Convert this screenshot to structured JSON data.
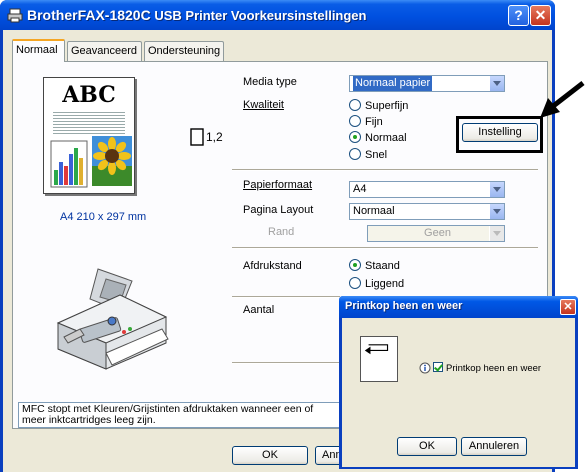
{
  "window": {
    "title_brand": "Brother",
    "title_model": "FAX-1820C",
    "title_rest": "USB Printer Voorkeursinstellingen",
    "help_label": "?",
    "close_label": "✕"
  },
  "tabs": [
    {
      "label": "Normaal",
      "active": true
    },
    {
      "label": "Geavanceerd",
      "active": false
    },
    {
      "label": "Ondersteuning",
      "active": false
    }
  ],
  "preview": {
    "sample_text": "ABC",
    "copies": "1,2",
    "paper_size_text": "A4 210 x 297 mm"
  },
  "media_type": {
    "label": "Media type",
    "value": "Normaal papier"
  },
  "quality": {
    "label": "Kwaliteit",
    "options": [
      {
        "label": "Superfijn",
        "selected": false
      },
      {
        "label": "Fijn",
        "selected": false
      },
      {
        "label": "Normaal",
        "selected": true
      },
      {
        "label": "Snel",
        "selected": false
      }
    ],
    "settings_button": "Instelling"
  },
  "paper_size": {
    "label": "Papierformaat",
    "value": "A4"
  },
  "page_layout": {
    "label": "Pagina Layout",
    "value": "Normaal"
  },
  "border": {
    "label": "Rand",
    "value": "Geen"
  },
  "orientation": {
    "label": "Afdrukstand",
    "options": [
      {
        "label": "Staand",
        "selected": true
      },
      {
        "label": "Liggend",
        "selected": false
      }
    ]
  },
  "copies": {
    "label": "Aantal"
  },
  "status_note": "MFC stopt met Kleuren/Grijstinten afdruktaken wanneer een of meer inktcartridges leeg zijn.",
  "footer": {
    "ok": "OK",
    "cancel_partial": "Ann"
  },
  "popup": {
    "title": "Printkop heen en weer",
    "close_label": "✕",
    "checkbox_label": "Printkop heen en weer",
    "checkbox_checked": true,
    "ok": "OK",
    "cancel": "Annuleren"
  },
  "colors": {
    "titlebar": "#0050e0",
    "client": "#ece9d8",
    "accent_tab": "#f5a623",
    "link_text": "#0033a0"
  }
}
